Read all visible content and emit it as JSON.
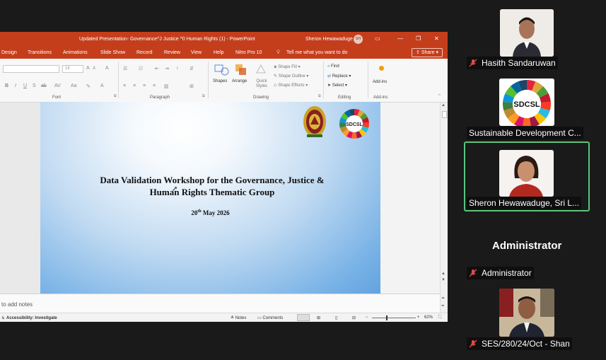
{
  "ppt": {
    "title": "Updated Presentation- Governance^J Justice ^0 Human Rights (1)  -  PowerPoint",
    "user": "Sheron Hewawaduge",
    "user_initials": "SH",
    "menu": [
      "Design",
      "Transitions",
      "Animations",
      "Slide Show",
      "Record",
      "Review",
      "View",
      "Help",
      "Nitro Pro 10"
    ],
    "tell_me": "Tell me what you want to do",
    "share": "Share",
    "ribbon": {
      "font_size": "18",
      "group_font": "Font",
      "group_paragraph": "Paragraph",
      "group_drawing": "Drawing",
      "group_editing": "Editing",
      "group_addins": "Add-ins",
      "shapes": "Shapes",
      "arrange": "Arrange",
      "quick_styles": "Quick Styles",
      "shape_fill": "Shape Fill",
      "shape_outline": "Shape Outline",
      "shape_effects": "Shape Effects",
      "find": "Find",
      "replace": "Replace",
      "select": "Select",
      "addins": "Add-ins"
    },
    "slide": {
      "heading_line1": "Data Validation Workshop for the Governance, Justice &",
      "heading_line2": "Human Rights Thematic Group",
      "date_day": "20",
      "date_suffix": "th",
      "date_rest": " May 2026",
      "logo_text": "SDCSL"
    },
    "notes_placeholder": "to add notes",
    "status": {
      "accessibility": "Accessibility: Investigate",
      "notes": "Notes",
      "comments": "Comments",
      "zoom": "62%"
    }
  },
  "participants": [
    {
      "name": "Hasith Sandaruwan",
      "muted": true
    },
    {
      "name": "Sustainable Development C...",
      "muted": false,
      "logo_text": "SDCSL"
    },
    {
      "name": "Sheron Hewawaduge, Sri L...",
      "muted": false,
      "active": true
    },
    {
      "name": "Administrator",
      "muted": true,
      "display": "Administrator"
    },
    {
      "name": "SES/280/24/Oct - Shan",
      "muted": true
    }
  ],
  "colors": {
    "powerpoint": "#c43e1c",
    "active_speaker": "#58c57a",
    "background": "#1a1a1a",
    "muted": "#e04a4a"
  }
}
